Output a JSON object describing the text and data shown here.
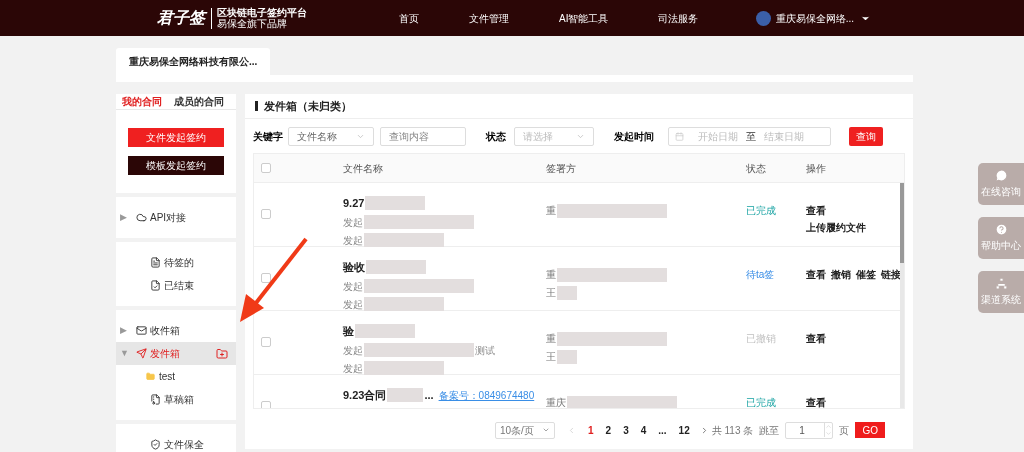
{
  "header": {
    "logo": "君子签",
    "logo_subtitle": "区块链电子签约平台",
    "logo_tagline": "易保全旗下品牌",
    "nav": [
      "首页",
      "文件管理",
      "AI智能工具",
      "司法服务"
    ],
    "user": "重庆易保全网络..."
  },
  "company_tab": "重庆易保全网络科技有限公...",
  "sidebar": {
    "tabs": [
      {
        "label": "我的合同",
        "selected": true
      },
      {
        "label": "成员的合同",
        "selected": false
      }
    ],
    "buttons": [
      {
        "label": "文件发起签约",
        "kind": "primary"
      },
      {
        "label": "模板发起签约",
        "kind": "dark"
      }
    ],
    "groups": [
      [
        {
          "label": "API对接",
          "kind": "cloud",
          "arrow": "▶",
          "selected": false
        }
      ],
      [
        {
          "label": "待签的",
          "kind": "pending",
          "selected": false
        },
        {
          "label": "已结束",
          "kind": "finished",
          "selected": false
        }
      ],
      [
        {
          "label": "收件箱",
          "kind": "inbox",
          "arrow": "▶",
          "selected": false
        },
        {
          "label": "发件箱",
          "kind": "outbox",
          "arrow": "▼",
          "selected": true,
          "children": [
            {
              "label": "test"
            }
          ]
        },
        {
          "label": "草稿箱",
          "kind": "drafts",
          "selected": false
        }
      ],
      [
        {
          "label": "文件保全",
          "kind": "protect",
          "selected": false
        }
      ]
    ]
  },
  "main": {
    "title": "发件箱（未归类）",
    "filters": {
      "keyword_label": "关键字",
      "keyword_type": "文件名称",
      "keyword_placeholder": "查询内容",
      "status_label": "状态",
      "status_placeholder": "请选择",
      "time_label": "发起时间",
      "start_placeholder": "开始日期",
      "separator": "至",
      "end_placeholder": "结束日期",
      "search_button": "查询"
    },
    "table": {
      "select_all_checked": false,
      "columns": [
        "文件名称",
        "签署方",
        "状态",
        "操作"
      ],
      "rows": [
        {
          "checked": false,
          "name": "9.27",
          "lines": [
            "发起",
            "发起"
          ],
          "signers": [
            "重"
          ],
          "status": {
            "text": "已完成",
            "kind": "done"
          },
          "action_lines": [
            [
              "查看"
            ],
            [
              "上传履约文件"
            ]
          ]
        },
        {
          "checked": false,
          "name": "验收",
          "lines": [
            "发起",
            "发起"
          ],
          "signers": [
            "重",
            "王"
          ],
          "status": {
            "text": "待ta签",
            "kind": "pending"
          },
          "action_lines": [
            [
              "查看",
              "撤销",
              "催签",
              "链接"
            ]
          ]
        },
        {
          "checked": false,
          "name": "验",
          "lines": [
            "发起",
            "发起"
          ],
          "line_suffix": "测试",
          "signers": [
            "重",
            "王"
          ],
          "status": {
            "text": "已撤销",
            "kind": "revoked"
          },
          "action_lines": [
            [
              "查看"
            ]
          ]
        },
        {
          "checked": false,
          "name": "9.23合同",
          "name_suffix": "...",
          "record": "备案号：0849674480",
          "lines": [],
          "signers": [
            "重庆"
          ],
          "status": {
            "text": "已完成",
            "kind": "done"
          },
          "action_lines": [
            [
              "查看"
            ]
          ]
        }
      ]
    },
    "pagination": {
      "page_size": "10条/页",
      "pages": [
        {
          "label": "1",
          "selected": true
        },
        {
          "label": "2",
          "selected": false
        },
        {
          "label": "3",
          "selected": false
        },
        {
          "label": "4",
          "selected": false
        },
        {
          "label": "...",
          "selected": false
        },
        {
          "label": "12",
          "selected": false
        }
      ],
      "total": "共 113 条",
      "jump_label": "跳至",
      "jump_value": "1",
      "page_unit": "页",
      "go": "GO"
    }
  },
  "float_buttons": [
    {
      "label": "在线咨询",
      "kind": "chat"
    },
    {
      "label": "帮助中心",
      "kind": "help"
    },
    {
      "label": "渠道系统",
      "kind": "channels"
    }
  ]
}
